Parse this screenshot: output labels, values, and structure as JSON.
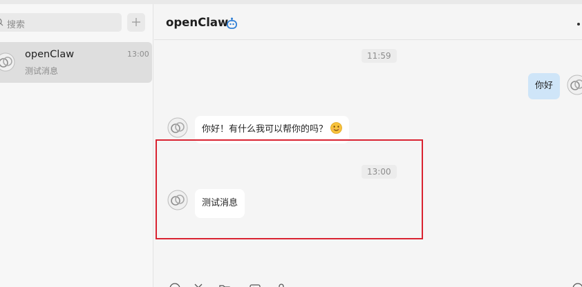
{
  "sidebar": {
    "search_placeholder": "搜索",
    "chats": [
      {
        "name": "openClaw",
        "time": "13:00",
        "preview": "测试消息"
      }
    ]
  },
  "header": {
    "title": "openClaw"
  },
  "messages": {
    "time1": "11:59",
    "me_text": "你好",
    "bot_reply": "你好！有什么我可以帮你的吗？",
    "time2": "13:00",
    "test_text": "测试消息"
  },
  "colors": {
    "accent_blue": "#2f7fd6",
    "my_bubble": "#cfe5f8",
    "highlight_red": "#d92230"
  },
  "icons": [
    "search-icon",
    "plus-icon",
    "bot-icon",
    "more-icon",
    "smile-emoji",
    "emoji-icon",
    "scissors-icon",
    "folder-icon",
    "image-icon",
    "mic-icon",
    "chat-icon"
  ]
}
